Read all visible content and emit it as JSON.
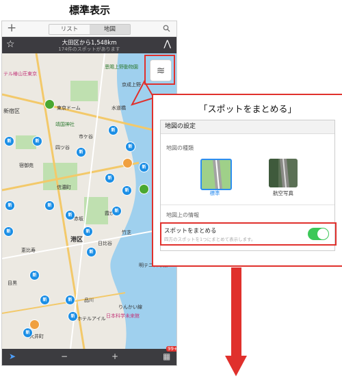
{
  "title": "標準表示",
  "header": {
    "tabs": [
      "リスト",
      "地図"
    ],
    "active_tab": "地図"
  },
  "info": {
    "line1": "大田区から1,548km",
    "line2": "174件のスポットがあります"
  },
  "map": {
    "labels": [
      "テル椿山荘東京",
      "新宿区",
      "恩賜上野動物園",
      "京成上野",
      "水道橋",
      "東京ドーム",
      "靖国神社",
      "市ケ谷",
      "四ツ谷",
      "信濃町",
      "宿御苑",
      "霞が関",
      "赤坂",
      "港区",
      "日比谷",
      "竹芝",
      "恵比寿",
      "目黒",
      "品川",
      "明テニスの森",
      "りんかい線",
      "日本科学未来館",
      "ホテルアイル",
      "大井町"
    ],
    "pin_text": "新"
  },
  "bottom": {
    "minus": "−",
    "plus": "+",
    "badge": "99+"
  },
  "callout": {
    "title": "「スポットをまとめる」",
    "panel_title": "地図の設定",
    "section_map_type": "地図の種類",
    "option_standard": "標準",
    "option_aerial": "航空写真",
    "section_info": "地図上の情報",
    "toggle_label": "スポットをまとめる",
    "toggle_sub": "四方のスポットを1つにまとめて表示します。",
    "toggle_on": true
  },
  "colors": {
    "accent": "#e0302c",
    "pin": "#1b8ee5",
    "toggle": "#3cc858"
  }
}
